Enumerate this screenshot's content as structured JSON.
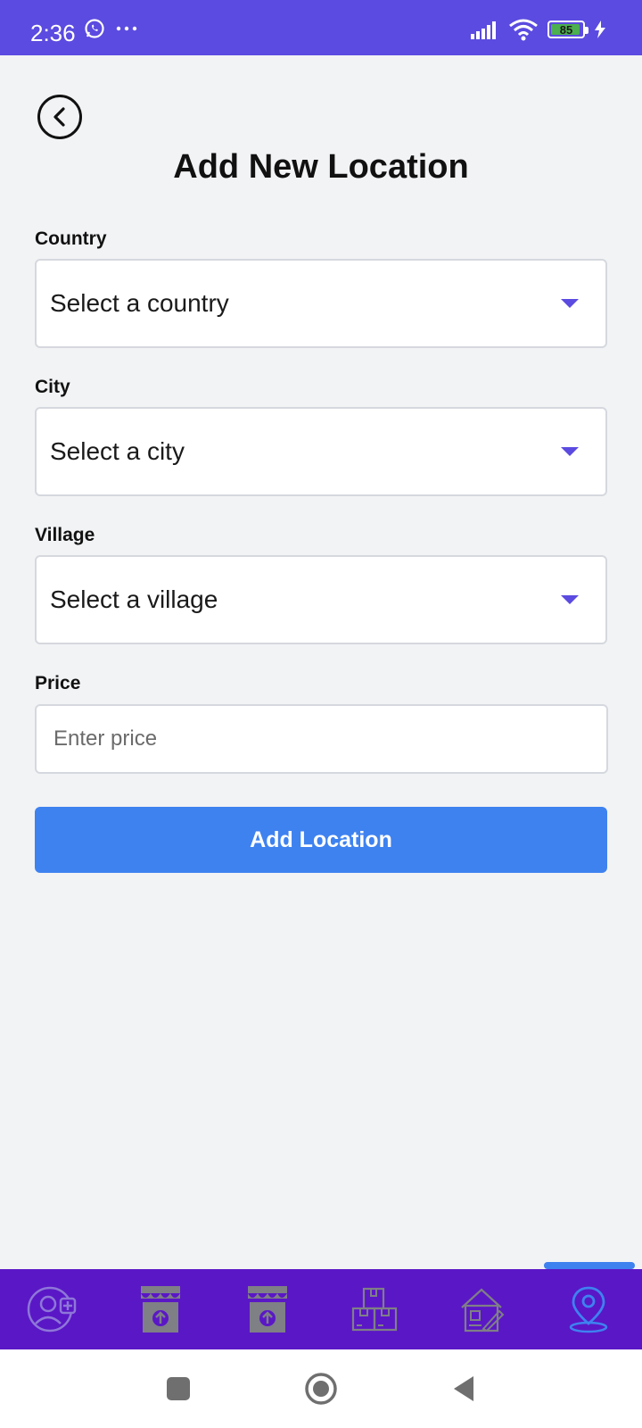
{
  "status_bar": {
    "time": "2:36",
    "battery_level": "85",
    "accent_color": "#5b4be0"
  },
  "header": {
    "back_icon": "chevron-left-circle-icon",
    "title": "Add New Location"
  },
  "form": {
    "country": {
      "label": "Country",
      "value": "Select a country"
    },
    "city": {
      "label": "City",
      "value": "Select a city"
    },
    "village": {
      "label": "Village",
      "value": "Select a village"
    },
    "price": {
      "label": "Price",
      "placeholder": "Enter price"
    },
    "submit_label": "Add Location",
    "submit_color": "#3e82f0"
  },
  "bottom_nav": {
    "background": "#5a17c6",
    "active_index": 5,
    "items": [
      {
        "icon": "add-user-icon"
      },
      {
        "icon": "store-upload-icon"
      },
      {
        "icon": "store-upload-icon"
      },
      {
        "icon": "boxes-icon"
      },
      {
        "icon": "house-edit-icon"
      },
      {
        "icon": "location-pin-icon"
      }
    ]
  },
  "system_nav": {
    "items": [
      "recents-icon",
      "home-icon",
      "back-icon"
    ]
  }
}
